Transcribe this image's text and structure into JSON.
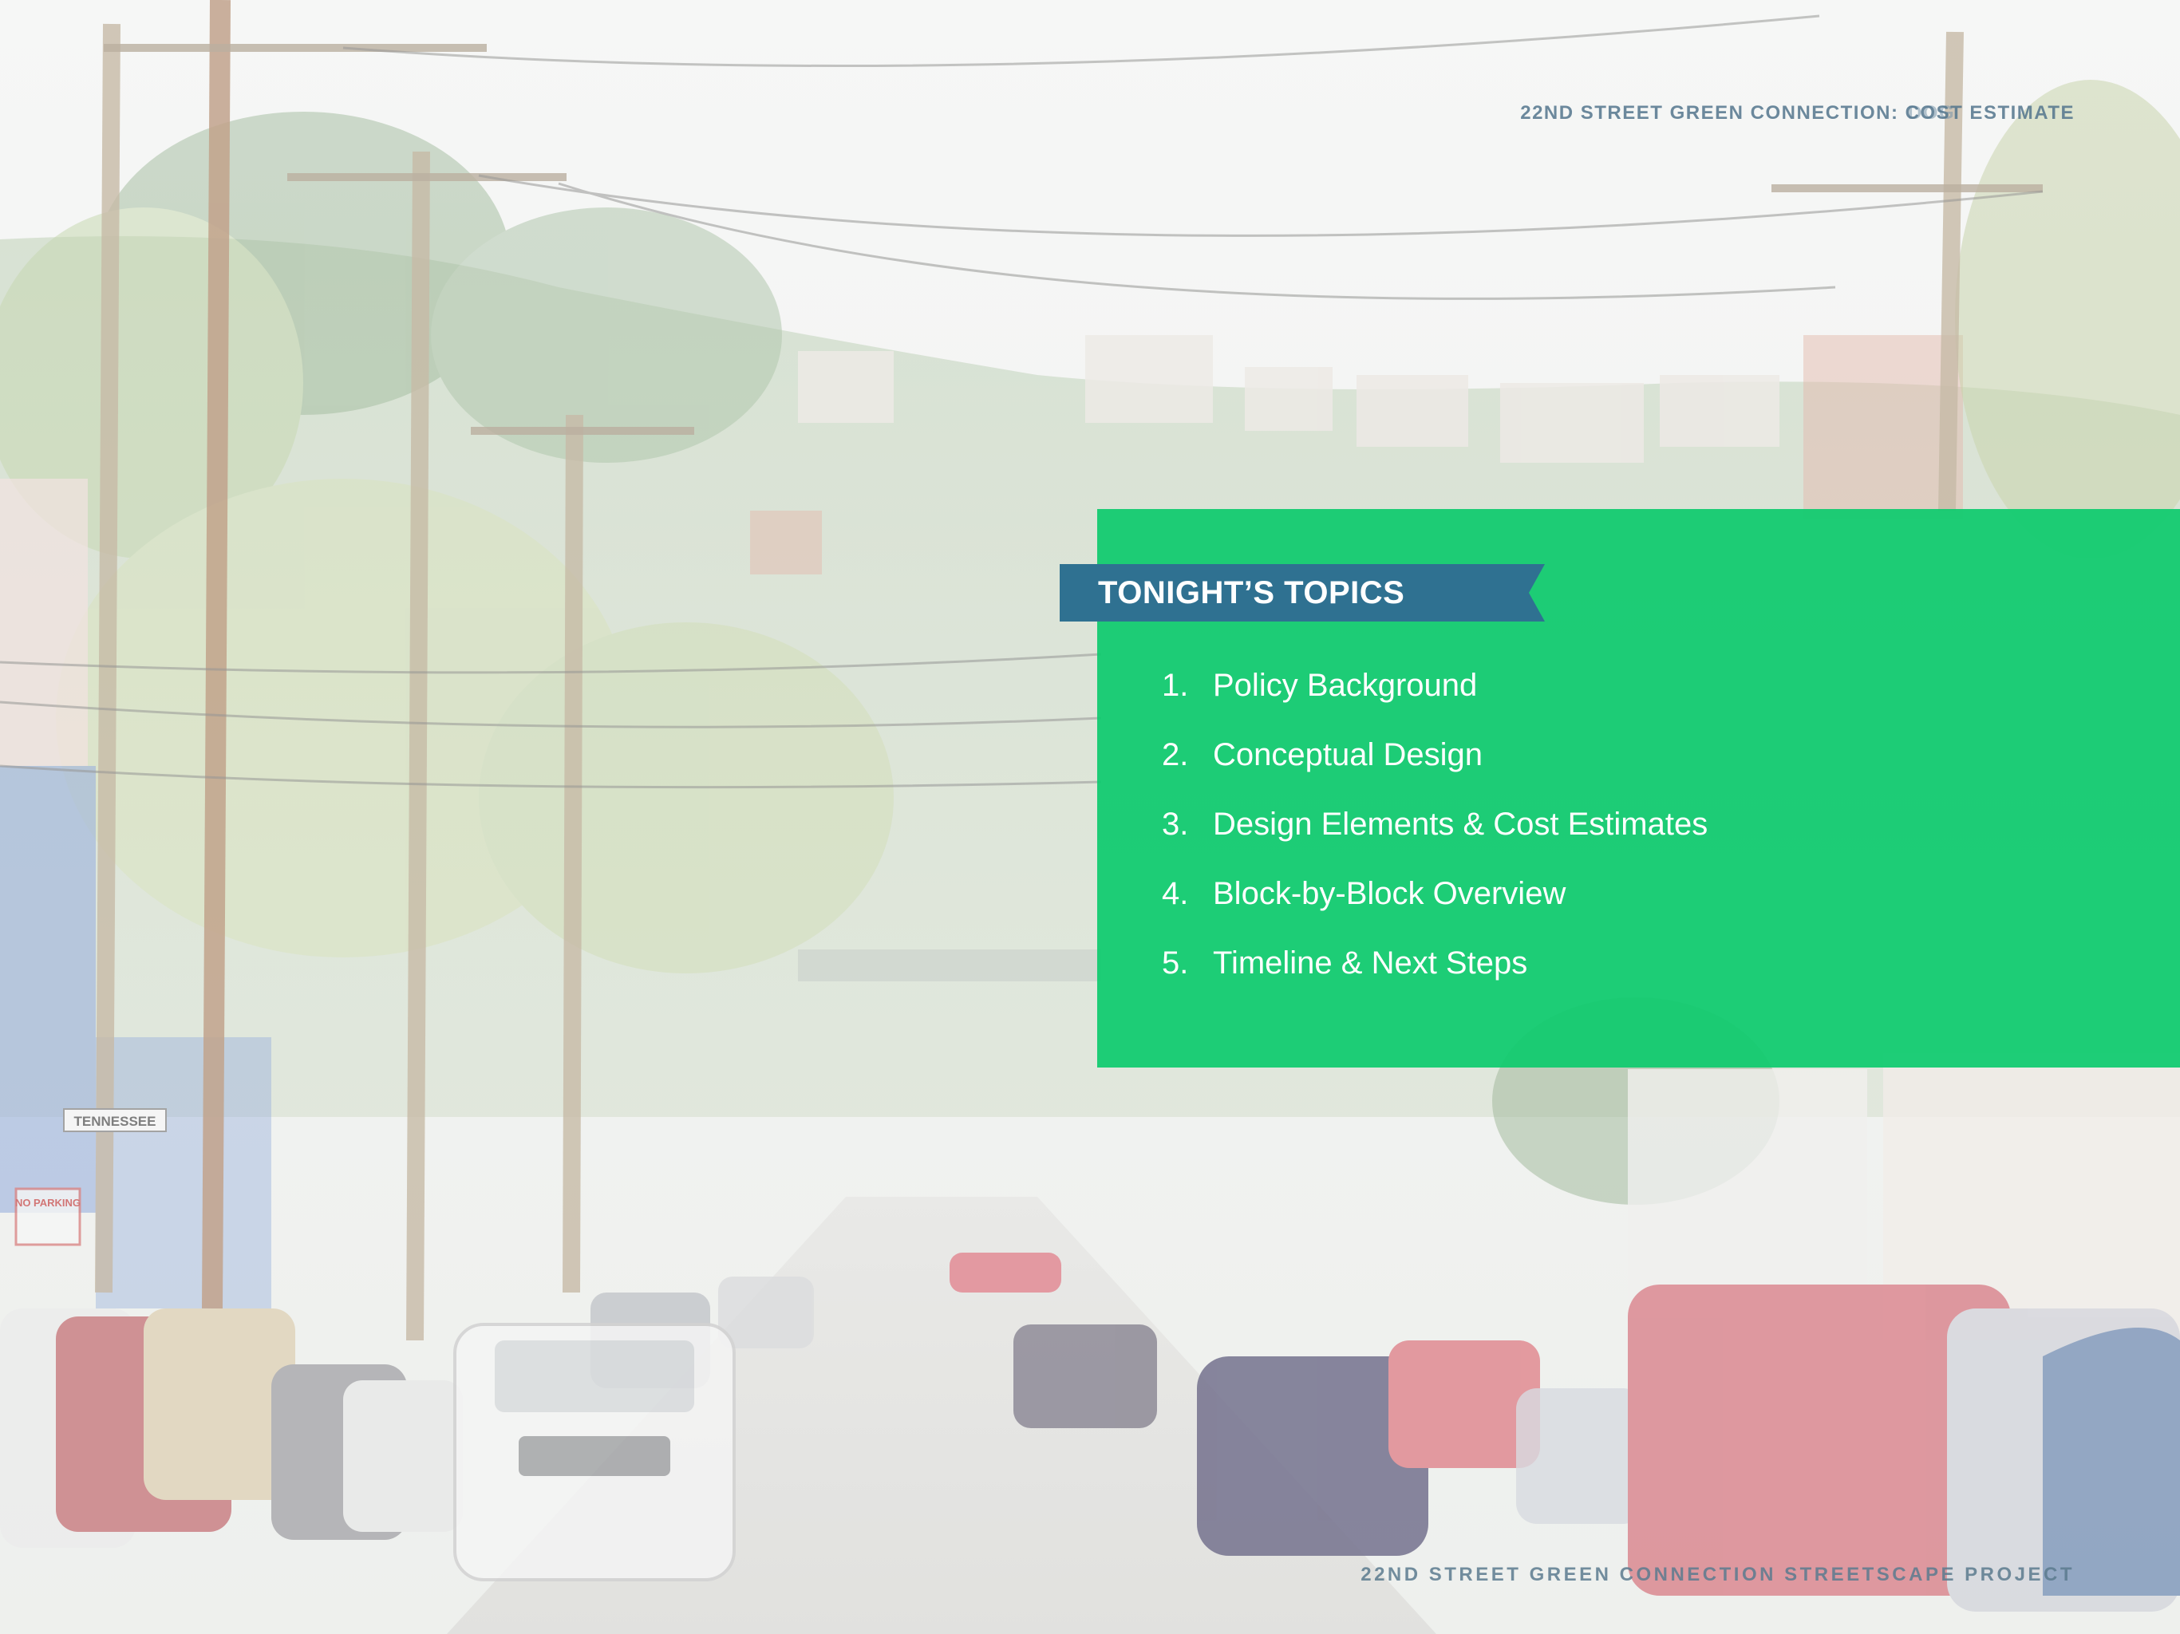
{
  "header": {
    "title": "22ND STREET GREEN CONNECTION: COST ESTIMATE",
    "ghost_prefix": "DOG"
  },
  "topics": {
    "heading": "TONIGHT’S TOPICS",
    "items": [
      {
        "number": "1.",
        "label": "Policy Background"
      },
      {
        "number": "2.",
        "label": "Conceptual Design"
      },
      {
        "number": "3.",
        "label": "Design Elements & Cost Estimates"
      },
      {
        "number": "4.",
        "label": "Block-by-Block Overview"
      },
      {
        "number": "5.",
        "label": "Timeline & Next Steps"
      }
    ]
  },
  "footer": {
    "title": "22ND  STREET GREEN CONNECTION STREETSCAPE PROJECT"
  },
  "photo_signs": {
    "street_sign": "TENNESSEE",
    "parking_sign": "NO PARKING"
  },
  "colors": {
    "panel_green": "#0ECA6E",
    "banner_blue": "#2F7191",
    "header_text": "#52748C"
  }
}
